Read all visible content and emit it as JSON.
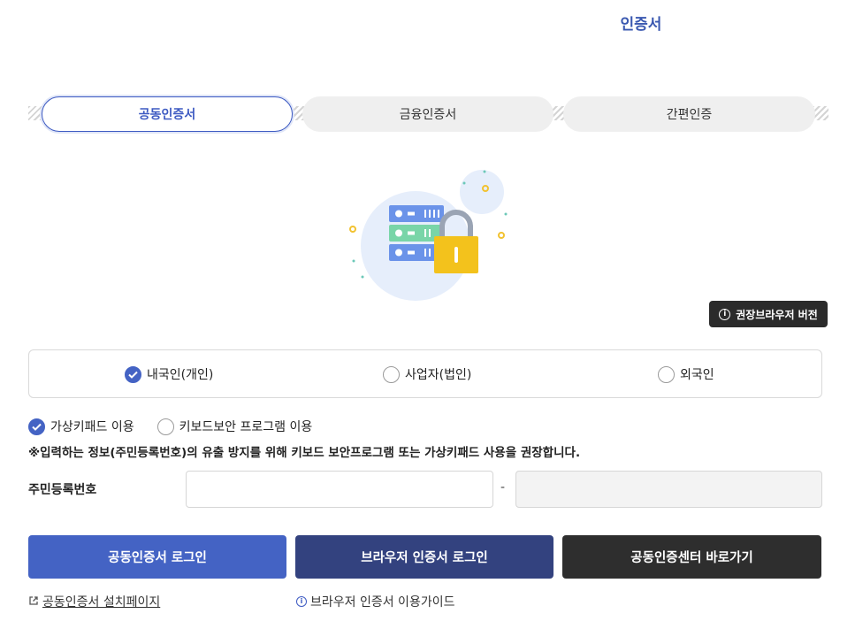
{
  "page": {
    "title": "인증서"
  },
  "tabs": [
    {
      "label": "공동인증서",
      "active": true
    },
    {
      "label": "금융인증서",
      "active": false
    },
    {
      "label": "간편인증",
      "active": false
    }
  ],
  "badge": {
    "icon": "info-icon",
    "label": "권장브라우저 버전"
  },
  "user_types": [
    {
      "label": "내국인(개인)",
      "checked": true
    },
    {
      "label": "사업자(법인)",
      "checked": false
    },
    {
      "label": "외국인",
      "checked": false
    }
  ],
  "keyboard_options": [
    {
      "label": "가상키패드 이용",
      "checked": true
    },
    {
      "label": "키보드보안 프로그램 이용",
      "checked": false
    }
  ],
  "notice": "※입력하는 정보(주민등록번호)의 유출 방지를 위해 키보드 보안프로그램 또는 가상키패드 사용을 권장합니다.",
  "id_field": {
    "label": "주민등록번호",
    "first_value": "",
    "second_value": "",
    "separator": "-"
  },
  "buttons": {
    "joint_login": "공동인증서 로그인",
    "browser_login": "브라우저 인증서 로그인",
    "center_link": "공동인증센터 바로가기"
  },
  "links": {
    "install_page": "공동인증서 설치페이지",
    "browser_guide": "브라우저 인증서 이용가이드"
  },
  "colors": {
    "primary": "#4463c4",
    "navy": "#33427f",
    "dark": "#2e2e2e",
    "title": "#3a58b0"
  }
}
